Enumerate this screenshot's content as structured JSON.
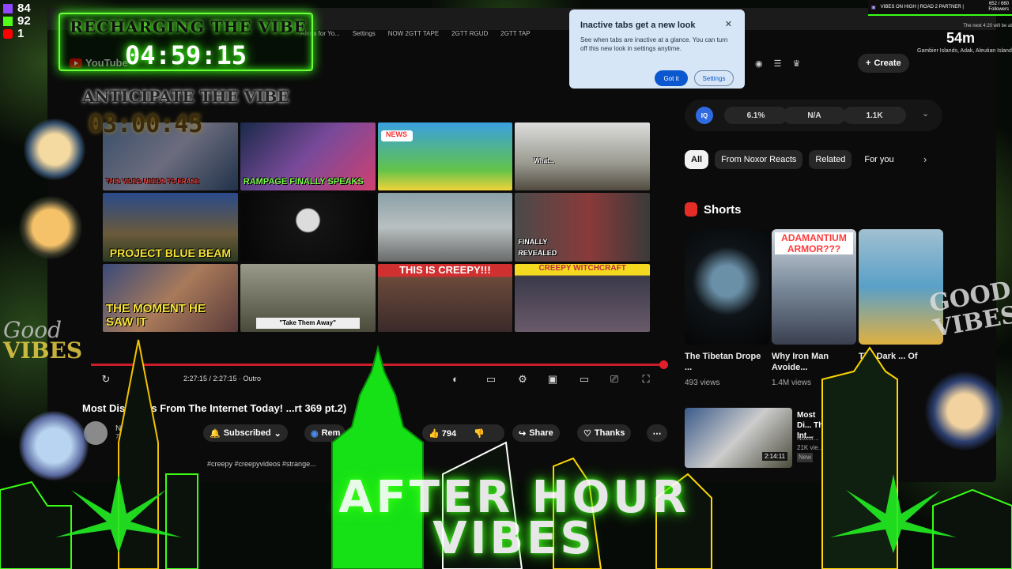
{
  "overlay": {
    "counters": [
      {
        "platform_icon": "twitch-icon",
        "value": "84"
      },
      {
        "platform_icon": "kick-icon",
        "value": "92"
      },
      {
        "platform_icon": "youtube-icon",
        "value": "1"
      }
    ],
    "timer_label": "RECHARGING THE VIBE",
    "timer_value": "04:59:15",
    "anticipate_label": "ANTICIPATE THE VIBE",
    "countdown_value": "03:00:45",
    "good_vibes_left": [
      "Good",
      "VIBES"
    ],
    "good_vibes_right": [
      "GOOD",
      "VIBES"
    ],
    "weather": {
      "header": "The next 4:20 will be at",
      "value": "54m",
      "location": "Gambier Islands, Adak, Aleutian Islands"
    },
    "stream_bar": {
      "title": "VIBES ON HIGH | ROAD 2 PARTNER |",
      "followers": "652 / 660",
      "followers_label": "Followers"
    },
    "banner": [
      "AFTER HOUR",
      "VIBES"
    ],
    "accent_color": "#39ff14"
  },
  "browser": {
    "bookmarks": [
      "Alerts for Yo...",
      "Settings",
      "NOW 2GTT TAPE",
      "2GTT RGUD",
      "2GTT TAP"
    ],
    "popup": {
      "title": "Inactive tabs get a new look",
      "body": "See when tabs are inactive at a glance. You can turn off this new look in settings anytime.",
      "got_it": "Got it",
      "settings": "Settings"
    }
  },
  "youtube": {
    "logo_text": "YouTube",
    "create_label": "Create",
    "thumbnails": [
      {
        "caption": "THIS VIDEO NEEDS TO ERASE",
        "banner": "",
        "caption_color": "red"
      },
      {
        "caption": "RAMPAGE FINALLY SPEAKS",
        "banner": "",
        "caption_color": "green"
      },
      {
        "caption": "",
        "banner": "NEWS",
        "caption_color": "white"
      },
      {
        "caption": "What...",
        "banner": "",
        "caption_color": "white"
      },
      {
        "caption": "PROJECT BLUE BEAM",
        "banner": "",
        "caption_color": "yellow"
      },
      {
        "caption": "",
        "banner": "",
        "caption_color": "white"
      },
      {
        "caption": "",
        "banner": "",
        "caption_color": "white"
      },
      {
        "caption": "FINALLY REVEALED",
        "banner": "",
        "caption_color": "white"
      },
      {
        "caption": "THE MOMENT HE SAW IT",
        "banner": "",
        "caption_color": "yellow"
      },
      {
        "caption": "\"Take Them Away\"",
        "banner": "",
        "caption_color": "white"
      },
      {
        "caption": "",
        "banner": "THIS IS CREEPY!!!",
        "caption_color": "white"
      },
      {
        "caption": "",
        "banner": "CREEPY WITCHCRAFT",
        "caption_color": "white"
      }
    ],
    "player": {
      "time": "2:27:15 / 2:27:15 · Outro",
      "progress": 1.0
    },
    "video_title": "Most Dis... ...os From The Internet Today! ...rt 369 pt.2)",
    "channel_name": "Ne...",
    "channel_subs": "77...",
    "subscribed_label": "Subscribed",
    "remix_label": "Rem...",
    "like_count": "794",
    "share_label": "Share",
    "thanks_label": "Thanks",
    "description": "#creepy #creepyvideos #strange...",
    "stats": [
      {
        "label": "6.1%"
      },
      {
        "label": "N/A"
      },
      {
        "label": "1.1K"
      }
    ],
    "iq_label": "IQ",
    "chips": [
      "All",
      "From Noxor Reacts",
      "Related",
      "For you"
    ],
    "shorts_title": "Shorts",
    "shorts": [
      {
        "caption": "",
        "title": "The Tibetan Drope ...",
        "views": "493 views"
      },
      {
        "caption": "ADAMANTIUM ARMOR???",
        "title": "Why Iron Man Avoide...",
        "views": "1.4M views"
      },
      {
        "caption": "",
        "title": "The Dark ... Of The...",
        "views": "...views"
      }
    ],
    "recommended": {
      "title": "Most Di... The Int...",
      "channel": "Noxor...",
      "views": "21K vie...",
      "badge": "New",
      "duration": "2:14:11"
    }
  }
}
